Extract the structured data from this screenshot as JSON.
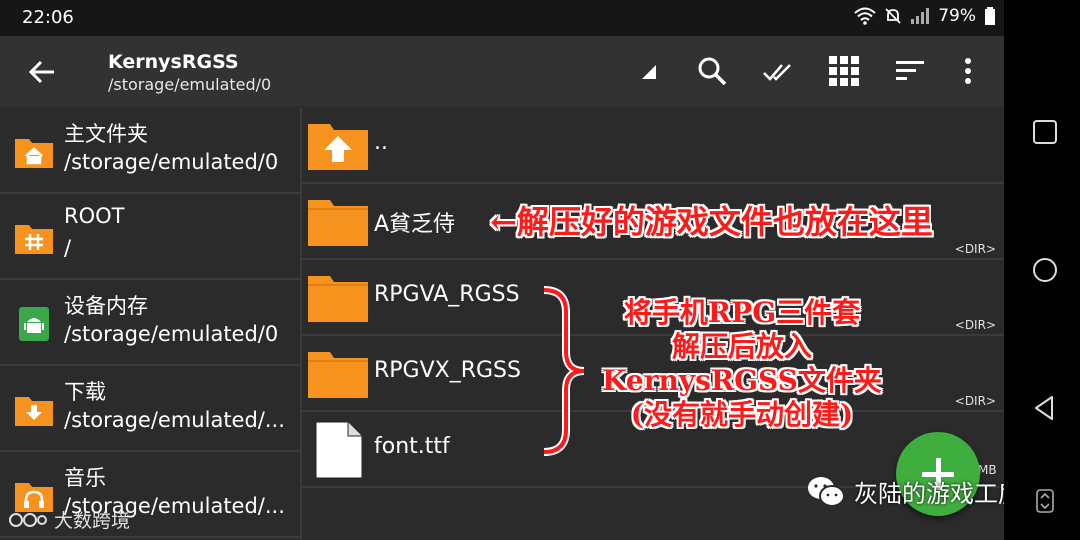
{
  "status": {
    "time": "22:06",
    "battery": "79%"
  },
  "appbar": {
    "title": "KernysRGSS",
    "path": "/storage/emulated/0"
  },
  "sidebar": {
    "items": [
      {
        "label": "主文件夹",
        "path": "/storage/emulated/0",
        "icon": "home-icon"
      },
      {
        "label": "ROOT",
        "path": "/",
        "icon": "hash-icon"
      },
      {
        "label": "设备内存",
        "path": "/storage/emulated/0",
        "icon": "android-icon"
      },
      {
        "label": "下载",
        "path": "/storage/emulated/...",
        "icon": "download-icon"
      },
      {
        "label": "音乐",
        "path": "/storage/emulated/...",
        "icon": "headphones-icon"
      }
    ]
  },
  "files": [
    {
      "name": "..",
      "meta": ""
    },
    {
      "name": "A貧乏侍",
      "meta": "<DIR>"
    },
    {
      "name": "RPGVA_RGSS",
      "meta": "<DIR>"
    },
    {
      "name": "RPGVX_RGSS",
      "meta": "<DIR>"
    },
    {
      "name": "font.ttf",
      "meta": "MB"
    }
  ],
  "annotations": {
    "arrow_note": "←解压好的游戏文件也放在这里",
    "brace_note": [
      "将手机RPG三件套",
      "解压后放入",
      "KernysRGSS文件夹",
      "(没有就手动创建)"
    ]
  },
  "watermark": {
    "right": "灰陆的游戏工房",
    "left": "大数跨境"
  },
  "colors": {
    "folder": "#f5931e",
    "fab": "#3eae3e",
    "annotation": "#ff1a1a"
  }
}
